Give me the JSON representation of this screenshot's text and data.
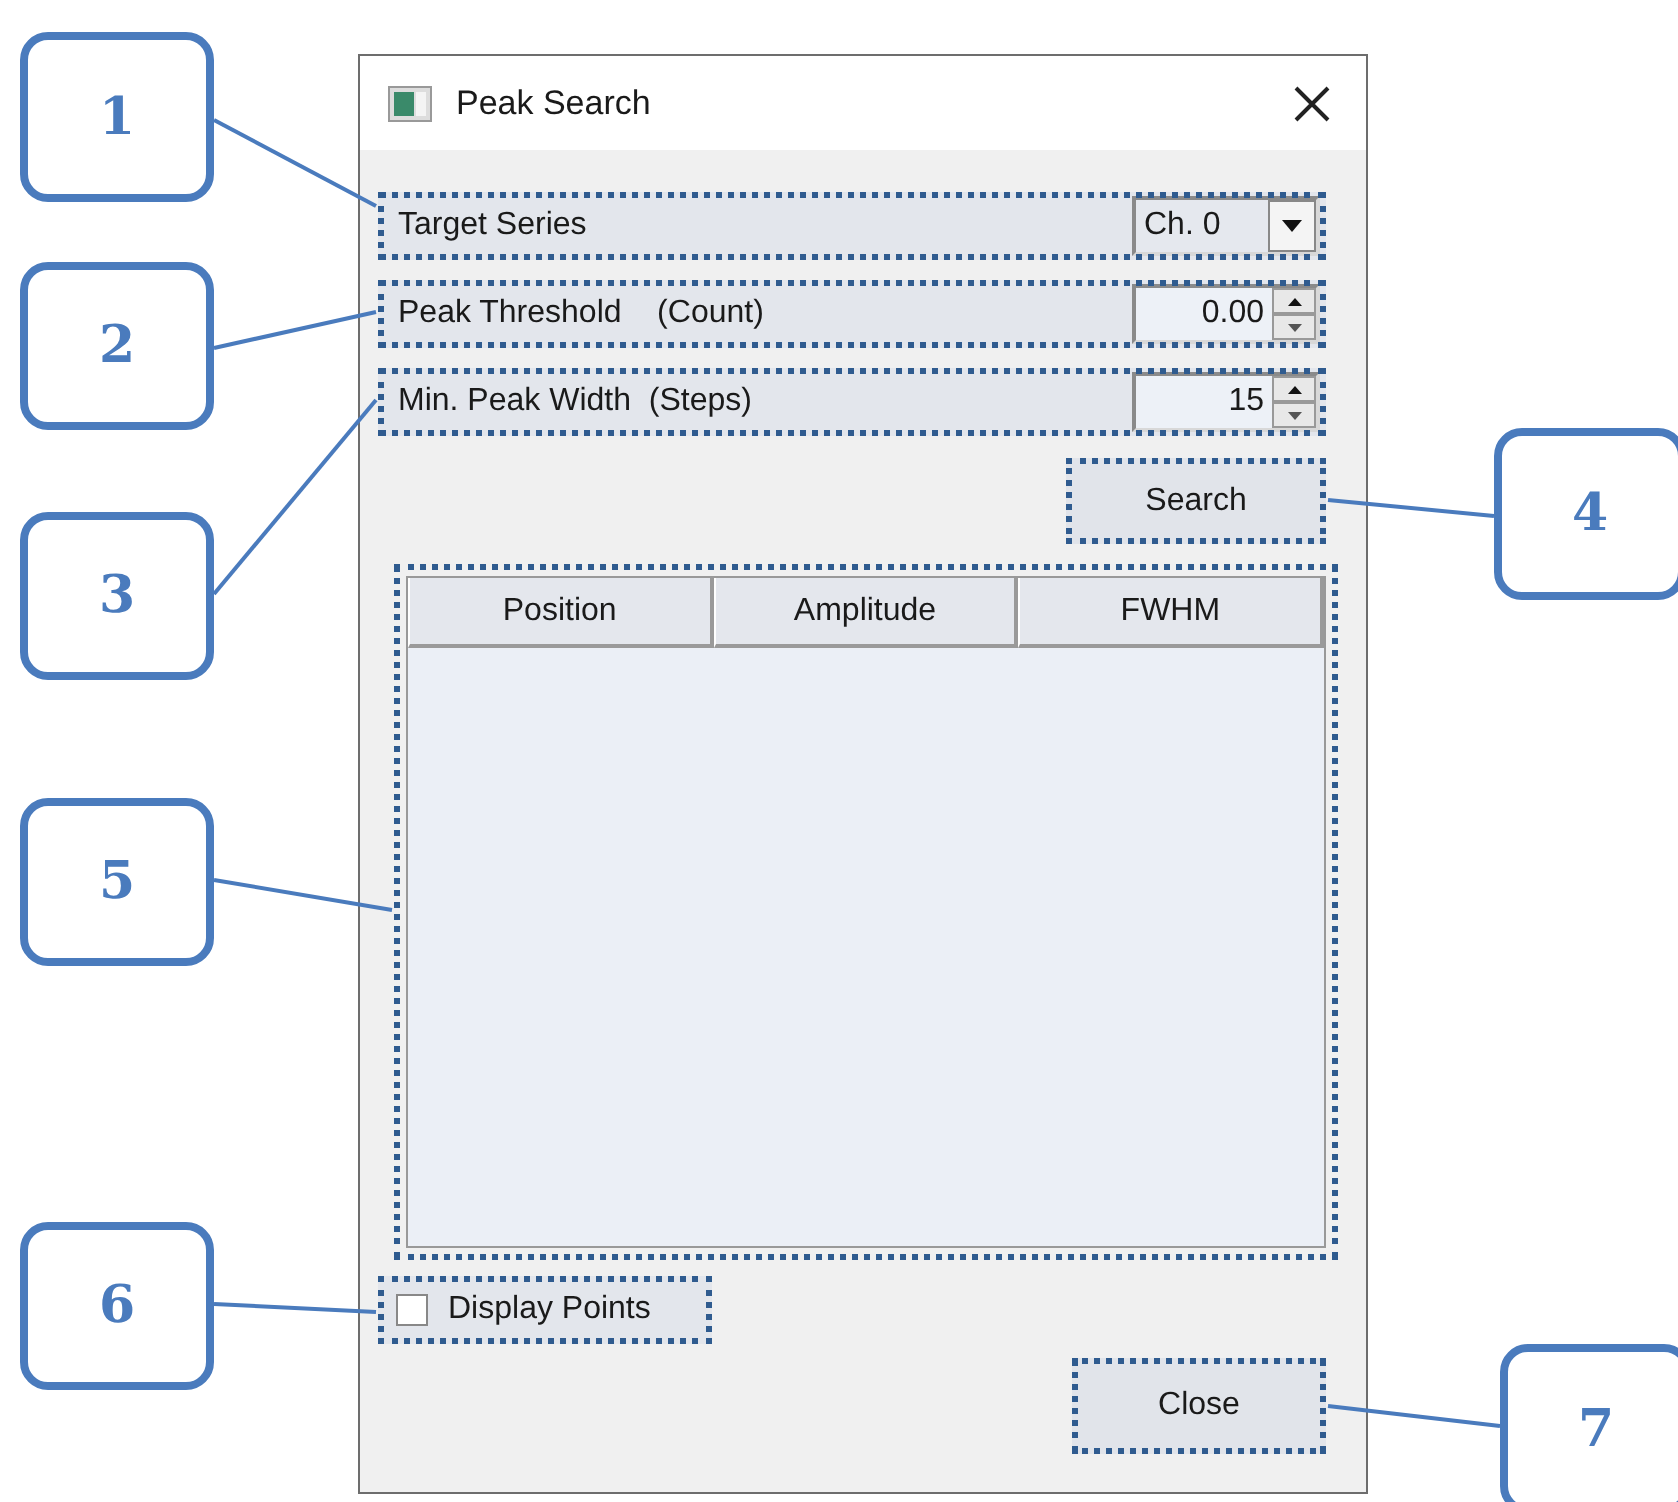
{
  "window": {
    "title": "Peak Search"
  },
  "fields": [
    {
      "kind": "dropdown",
      "label": "Target Series",
      "value": "Ch. 0"
    },
    {
      "kind": "spin",
      "label": "Peak Threshold    (Count)",
      "value": "0.00"
    },
    {
      "kind": "spin",
      "label": "Min. Peak Width  (Steps)",
      "value": "15"
    }
  ],
  "search_button": "Search",
  "table": {
    "columns": [
      "Position",
      "Amplitude",
      "FWHM"
    ]
  },
  "checkbox": {
    "label": "Display Points",
    "checked": false
  },
  "close_button": "Close",
  "callouts": [
    "1",
    "2",
    "3",
    "4",
    "5",
    "6",
    "7"
  ]
}
